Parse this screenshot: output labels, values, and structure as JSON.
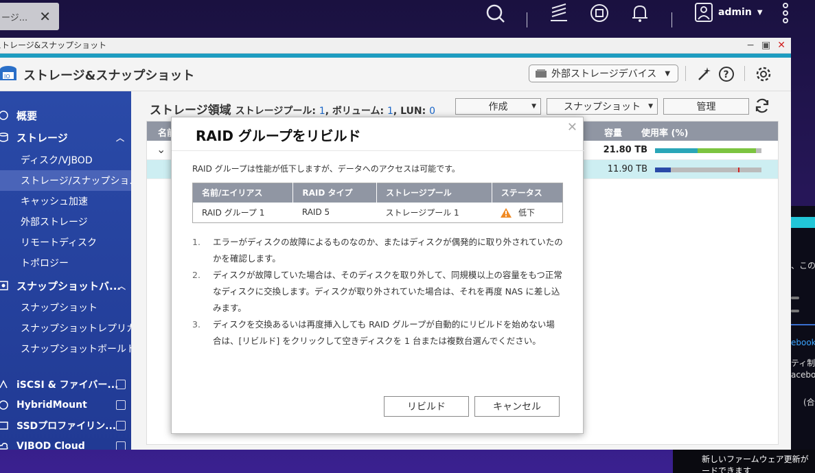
{
  "desktop": {
    "tab_label": "ージ...",
    "user_name": "admin",
    "toast_text_line1": "新しいファームウェア更新が",
    "toast_text_line2": "ードできます"
  },
  "background_right": {
    "line1": "、この",
    "line2": "ebook",
    "line3": "ティ制",
    "line4": "acebo",
    "line5": "(合"
  },
  "window": {
    "title": "ストレージ&スナップショット",
    "app_title": "ストレージ&スナップショット",
    "external_device_label": "外部ストレージデバイス"
  },
  "sidebar": {
    "overview": "概要",
    "storage_group": "ストレージ",
    "storage_items": [
      "ディスク/VJBOD",
      "ストレージ/スナップショ...",
      "キャッシュ加速",
      "外部ストレージ",
      "リモートディスク",
      "トポロジー"
    ],
    "snapshot_group": "スナップショットバ...",
    "snapshot_items": [
      "スナップショット",
      "スナップショットレプリカ",
      "スナップショットボールト"
    ],
    "links": [
      "iSCSI & ファイバー...",
      "HybridMount",
      "SSDプロファイリン...",
      "VJBOD Cloud"
    ]
  },
  "main": {
    "title": "ストレージ領域",
    "pool_label": "ストレージプール:",
    "pool_count": "1",
    "volume_label": "ボリューム:",
    "volume_count": "1",
    "lun_label": "LUN:",
    "lun_count": "0",
    "create_btn": "作成",
    "snapshot_btn": "スナップショット",
    "manage_btn": "管理",
    "col_name": "名前",
    "col_capacity": "容量",
    "col_usage": "使用率 (%)",
    "rows": [
      {
        "capacity": "21.80 TB",
        "usage_frac": 0.95
      },
      {
        "capacity": "11.90 TB",
        "usage_frac": 0.15
      }
    ]
  },
  "modal": {
    "title": "RAID グループをリビルド",
    "description": "RAID グループは性能が低下しますが、データへのアクセスは可能です。",
    "columns": [
      "名前/エイリアス",
      "RAID タイプ",
      "ストレージプール",
      "ステータス"
    ],
    "row": [
      "RAID グループ 1",
      "RAID 5",
      "ストレージプール 1",
      "低下"
    ],
    "steps": [
      {
        "n": "1.",
        "text": "エラーがディスクの故障によるものなのか、またはディスクが偶発的に取り外されていたのかを確認します。"
      },
      {
        "n": "2.",
        "text": "ディスクが故障していた場合は、そのディスクを取り外して、同規模以上の容量をもつ正常なディスクに交換します。ディスクが取り外されていた場合は、それを再度 NAS に差し込みます。"
      },
      {
        "n": "3.",
        "text": "ディスクを交換あるいは再度挿入しても RAID グループが自動的にリビルドを始めない場合は、[リビルド] をクリックして空きディスクを 1 台または複数台選んでください。"
      }
    ],
    "rebuild_btn": "リビルド",
    "cancel_btn": "キャンセル"
  },
  "colors": {
    "sidebar": "#2a4aa8",
    "accent": "#1e9cc0",
    "table_header": "#9096a3",
    "warning": "#f08a24"
  }
}
